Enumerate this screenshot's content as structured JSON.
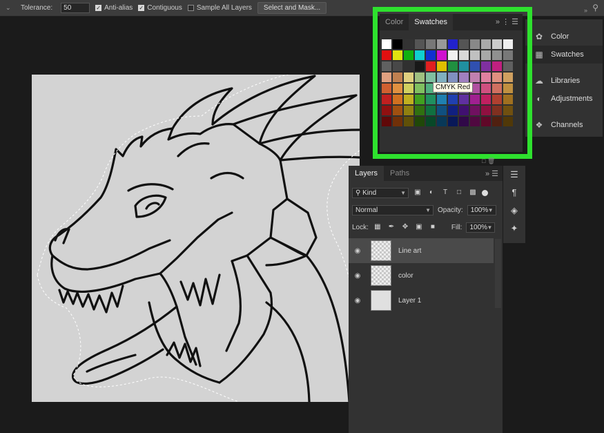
{
  "options_bar": {
    "tolerance_label": "Tolerance:",
    "tolerance_value": "50",
    "anti_alias_label": "Anti-alias",
    "contiguous_label": "Contiguous",
    "sample_all_layers_label": "Sample All Layers",
    "select_mask_label": "Select and Mask...",
    "anti_alias_checked": true,
    "contiguous_checked": true,
    "sample_all_layers_checked": false
  },
  "right_dock": {
    "items": [
      {
        "label": "Color",
        "icon": "palette-icon"
      },
      {
        "label": "Swatches",
        "icon": "grid-icon",
        "selected": true
      },
      {
        "label": "Libraries",
        "icon": "libraries-icon"
      },
      {
        "label": "Adjustments",
        "icon": "adjustments-icon"
      },
      {
        "label": "Channels",
        "icon": "channels-icon"
      }
    ]
  },
  "swatches_panel": {
    "tabs": [
      "Color",
      "Swatches"
    ],
    "active_tab": "Swatches",
    "tooltip": "CMYK Red",
    "highlight_color": "#2ee12e",
    "colors": [
      "#ffffff",
      "#000000",
      "#333333",
      "#555555",
      "#777777",
      "#999999",
      "#2222cc",
      "#555555",
      "#888888",
      "#aaaaaa",
      "#cccccc",
      "#eeeeee",
      "#e01010",
      "#e0e010",
      "#10b010",
      "#10d0d0",
      "#1030d0",
      "#d010d0",
      "#f0f0f0",
      "#d8d8d8",
      "#c0c0c0",
      "#a8a8a8",
      "#909090",
      "#787878",
      "#606060",
      "#484848",
      "#303030",
      "#181818",
      "#e02020",
      "#e0c000",
      "#209040",
      "#2090a0",
      "#3050b0",
      "#8030a0",
      "#c02080",
      "#606060",
      "#e0a080",
      "#c08050",
      "#e0d080",
      "#a0c080",
      "#80c0a0",
      "#80b0c0",
      "#8090c0",
      "#a080c0",
      "#c080b0",
      "#e080a0",
      "#e09080",
      "#d0a060",
      "#d06030",
      "#e09040",
      "#d0d060",
      "#80c060",
      "#50b080",
      "#50a0c0",
      "#5070c0",
      "#8060b0",
      "#b050a0",
      "#d05080",
      "#d07060",
      "#c09040",
      "#c02020",
      "#d07020",
      "#c0b020",
      "#40a020",
      "#209060",
      "#2080b0",
      "#2040b0",
      "#6030a0",
      "#a02090",
      "#c02060",
      "#b04030",
      "#a07020",
      "#901010",
      "#a05010",
      "#908010",
      "#307010",
      "#107040",
      "#105080",
      "#102080",
      "#401070",
      "#701060",
      "#901040",
      "#803020",
      "#705010",
      "#600808",
      "#703008",
      "#605008",
      "#204808",
      "#084828",
      "#083858",
      "#081858",
      "#300848",
      "#500840",
      "#600828",
      "#502010",
      "#503808"
    ]
  },
  "layers_panel": {
    "tabs": [
      "Layers",
      "Paths"
    ],
    "kind_label": "Kind",
    "blend_mode": "Normal",
    "opacity_label": "Opacity:",
    "opacity_value": "100%",
    "lock_label": "Lock:",
    "fill_label": "Fill:",
    "fill_value": "100%",
    "layers": [
      {
        "name": "Line art",
        "active": true
      },
      {
        "name": "color",
        "active": false
      },
      {
        "name": "Layer 1",
        "active": false
      }
    ]
  }
}
